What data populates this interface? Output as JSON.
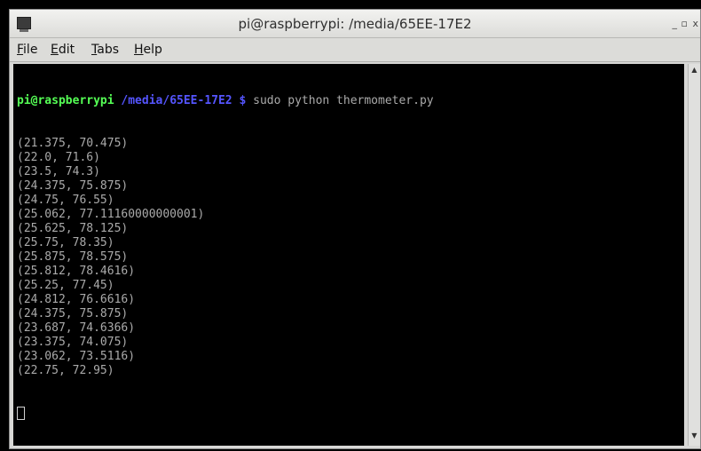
{
  "window": {
    "title": "pi@raspberrypi: /media/65EE-17E2",
    "controls": {
      "minimize": "_",
      "maximize": "▫",
      "close": "x"
    }
  },
  "menu": {
    "file": {
      "accel": "F",
      "rest": "ile"
    },
    "edit": {
      "accel": "E",
      "rest": "dit"
    },
    "tabs": {
      "accel": "T",
      "rest": "abs"
    },
    "help": {
      "accel": "H",
      "rest": "elp"
    }
  },
  "terminal": {
    "prompt_user": "pi@raspberrypi",
    "prompt_path": "/media/65EE-17E2",
    "prompt_symbol": "$",
    "command": "sudo python thermometer.py",
    "output": [
      "(21.375, 70.475)",
      "(22.0, 71.6)",
      "(23.5, 74.3)",
      "(24.375, 75.875)",
      "(24.75, 76.55)",
      "(25.062, 77.11160000000001)",
      "(25.625, 78.125)",
      "(25.75, 78.35)",
      "(25.875, 78.575)",
      "(25.812, 78.4616)",
      "(25.25, 77.45)",
      "(24.812, 76.6616)",
      "(24.375, 75.875)",
      "(23.687, 74.6366)",
      "(23.375, 74.075)",
      "(23.062, 73.5116)",
      "(22.75, 72.95)"
    ]
  },
  "colors": {
    "prompt_user": "#55ff55",
    "prompt_path": "#5555ff",
    "output_text": "#aaaaaa",
    "terminal_bg": "#000000"
  },
  "scrollbar": {
    "up_arrow": "▲",
    "down_arrow": "▼"
  }
}
